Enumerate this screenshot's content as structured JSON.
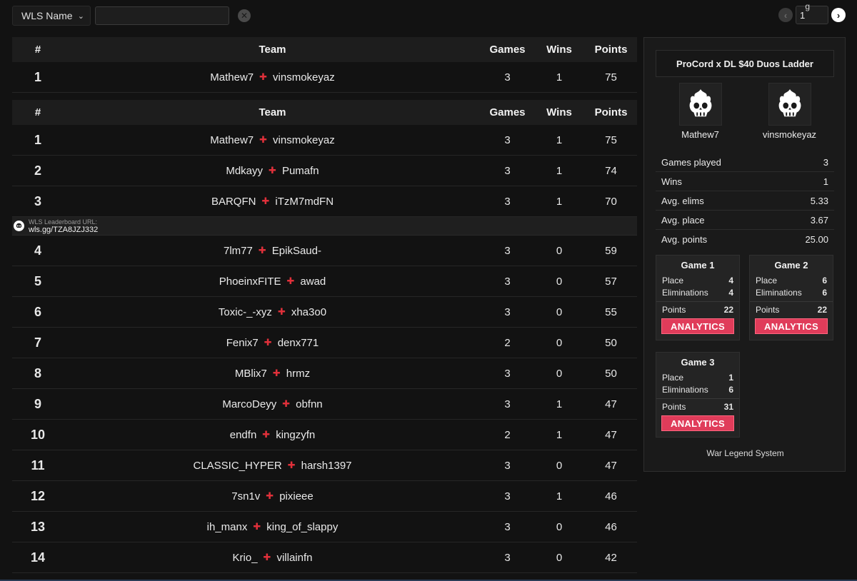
{
  "filter": {
    "selected": "WLS Name",
    "search_value": "",
    "search_placeholder": ""
  },
  "pager": {
    "page": "1",
    "corner_text": "g"
  },
  "table": {
    "headers": {
      "rank": "#",
      "team": "Team",
      "games": "Games",
      "wins": "Wins",
      "points": "Points"
    },
    "pinned": {
      "rank": "1",
      "p1": "Mathew7",
      "p2": "vinsmokeyaz",
      "games": "3",
      "wins": "1",
      "points": "75"
    },
    "rows_top": [
      {
        "rank": "1",
        "p1": "Mathew7",
        "p2": "vinsmokeyaz",
        "games": "3",
        "wins": "1",
        "points": "75"
      },
      {
        "rank": "2",
        "p1": "Mdkayy",
        "p2": "Pumafn",
        "games": "3",
        "wins": "1",
        "points": "74"
      },
      {
        "rank": "3",
        "p1": "BARQFN",
        "p2": "iTzM7mdFN",
        "games": "3",
        "wins": "1",
        "points": "70"
      }
    ],
    "url_banner": {
      "label": "WLS Leaderboard URL:",
      "value": "wls.gg/TZA8JZJ332"
    },
    "rows_bottom": [
      {
        "rank": "4",
        "p1": "7lm77",
        "p2": "EpikSaud-",
        "games": "3",
        "wins": "0",
        "points": "59"
      },
      {
        "rank": "5",
        "p1": "PhoeinxFITE",
        "p2": "awad",
        "games": "3",
        "wins": "0",
        "points": "57"
      },
      {
        "rank": "6",
        "p1": "Toxic-_-xyz",
        "p2": "xha3o0",
        "games": "3",
        "wins": "0",
        "points": "55"
      },
      {
        "rank": "7",
        "p1": "Fenix7",
        "p2": "denx771",
        "games": "2",
        "wins": "0",
        "points": "50"
      },
      {
        "rank": "8",
        "p1": "MBlix7",
        "p2": "hrmz",
        "games": "3",
        "wins": "0",
        "points": "50"
      },
      {
        "rank": "9",
        "p1": "MarcoDeyy",
        "p2": "obfnn",
        "games": "3",
        "wins": "1",
        "points": "47"
      },
      {
        "rank": "10",
        "p1": "endfn",
        "p2": "kingzyfn",
        "games": "2",
        "wins": "1",
        "points": "47"
      },
      {
        "rank": "11",
        "p1": "CLASSIC_HYPER",
        "p2": "harsh1397",
        "games": "3",
        "wins": "0",
        "points": "47"
      },
      {
        "rank": "12",
        "p1": "7sn1v",
        "p2": "pixieee",
        "games": "3",
        "wins": "1",
        "points": "46"
      },
      {
        "rank": "13",
        "p1": "ih_manx",
        "p2": "king_of_slappy",
        "games": "3",
        "wins": "0",
        "points": "46"
      },
      {
        "rank": "14",
        "p1": "Krio_",
        "p2": "villainfn",
        "games": "3",
        "wins": "0",
        "points": "42"
      }
    ]
  },
  "panel": {
    "title": "ProCord x DL $40 Duos Ladder",
    "players": [
      "Mathew7",
      "vinsmokeyaz"
    ],
    "stats": [
      {
        "label": "Games played",
        "value": "3"
      },
      {
        "label": "Wins",
        "value": "1"
      },
      {
        "label": "Avg. elims",
        "value": "5.33"
      },
      {
        "label": "Avg. place",
        "value": "3.67"
      },
      {
        "label": "Avg. points",
        "value": "25.00"
      }
    ],
    "games": [
      {
        "title": "Game 1",
        "place_label": "Place",
        "place": "4",
        "elims_label": "Eliminations",
        "elims": "4",
        "points_label": "Points",
        "points": "22",
        "button": "ANALYTICS"
      },
      {
        "title": "Game 2",
        "place_label": "Place",
        "place": "6",
        "elims_label": "Eliminations",
        "elims": "6",
        "points_label": "Points",
        "points": "22",
        "button": "ANALYTICS"
      },
      {
        "title": "Game 3",
        "place_label": "Place",
        "place": "1",
        "elims_label": "Eliminations",
        "elims": "6",
        "points_label": "Points",
        "points": "31",
        "button": "ANALYTICS"
      }
    ],
    "footer": "War Legend System"
  },
  "colors": {
    "accent": "#e03c5a",
    "plus": "#e0303a",
    "background": "#121212"
  },
  "icons": {
    "skull": "skull-flame-icon",
    "plus": "plus-icon",
    "clear": "clear-icon",
    "prev": "chevron-left-icon",
    "next": "chevron-right-icon",
    "dropdown": "chevron-down-icon"
  }
}
